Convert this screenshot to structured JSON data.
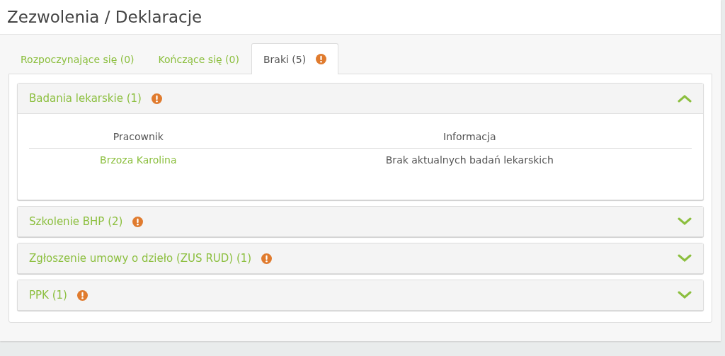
{
  "title": "Zezwolenia / Deklaracje",
  "tabs": [
    {
      "label": "Rozpoczynające się (0)",
      "selected": false,
      "alert": false
    },
    {
      "label": "Kończące się (0)",
      "selected": false,
      "alert": false
    },
    {
      "label": "Braki (5)",
      "selected": true,
      "alert": true
    }
  ],
  "panels": [
    {
      "title": "Badania lekarskie (1)",
      "alert": true,
      "expanded": true,
      "columns": [
        "Pracownik",
        "Informacja"
      ],
      "rows": [
        [
          "Brzoza Karolina",
          "Brak aktualnych badań lekarskich"
        ]
      ]
    },
    {
      "title": "Szkolenie BHP (2)",
      "alert": true,
      "expanded": false
    },
    {
      "title": "Zgłoszenie umowy o dzieło (ZUS RUD) (1)",
      "alert": true,
      "expanded": false
    },
    {
      "title": "PPK (1)",
      "alert": true,
      "expanded": false
    }
  ]
}
